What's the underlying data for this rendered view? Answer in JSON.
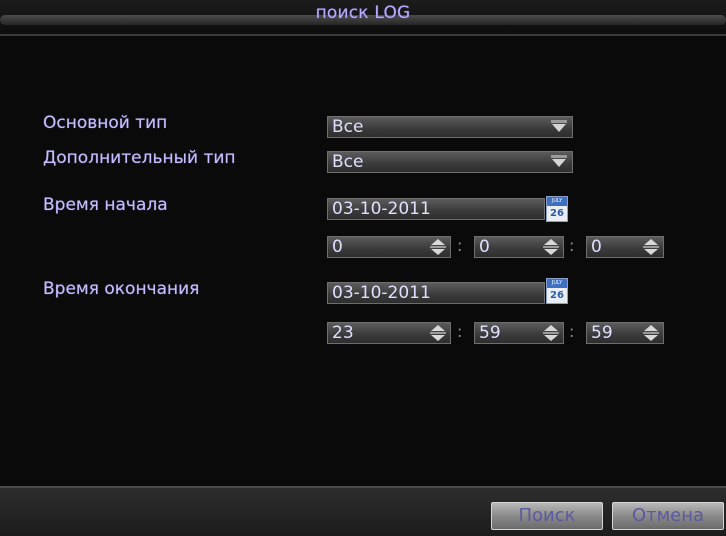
{
  "dialog": {
    "title": "поиск LOG"
  },
  "form": {
    "main_type": {
      "label": "Основной тип",
      "value": "Все"
    },
    "sub_type": {
      "label": "Дополнительный тип",
      "value": "Все"
    },
    "start": {
      "label": "Время начала",
      "date": "03-10-2011",
      "hour": "0",
      "minute": "0",
      "second": "0"
    },
    "end": {
      "label": "Время окончания",
      "date": "03-10-2011",
      "hour": "23",
      "minute": "59",
      "second": "59"
    },
    "time_separator": ":",
    "calendar_icon": {
      "month": "JULY",
      "day": "26"
    }
  },
  "buttons": {
    "search_label": "Поиск",
    "cancel_label": "Отмена"
  },
  "icons": {
    "dropdown": "chevron-down-icon",
    "calendar": "calendar-icon",
    "spinner": "spinner-updown-icon"
  }
}
